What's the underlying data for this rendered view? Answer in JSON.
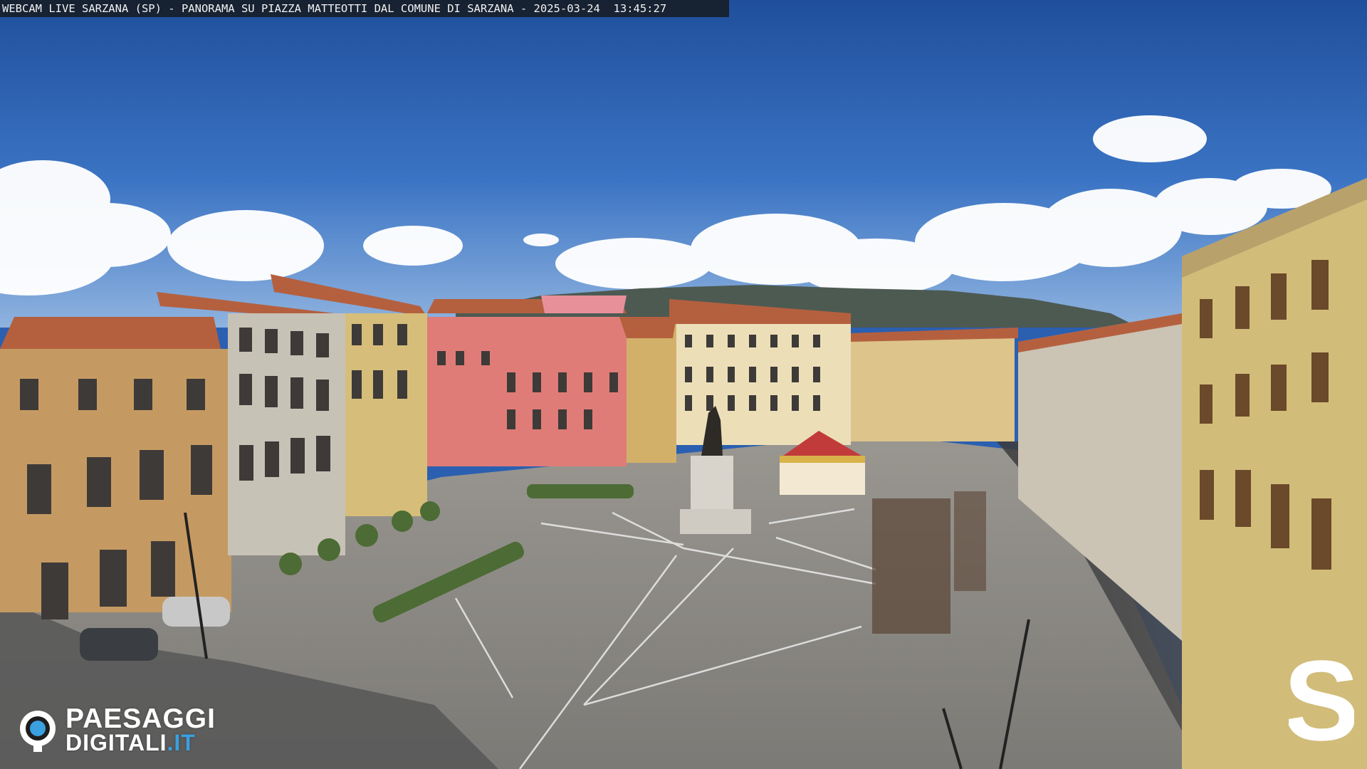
{
  "overlay": {
    "caption": "WEBCAM LIVE SARZANA (SP) - PANORAMA SU PIAZZA MATTEOTTI DAL COMUNE DI SARZANA - 2025-03-24  13:45:27"
  },
  "watermark": {
    "brand_line1": "PAESAGGI",
    "brand_line2": "DIGITALI",
    "brand_tld": ".IT",
    "corner_letter": "S",
    "accent_color": "#3aa0e0"
  },
  "colors": {
    "sky": "#2d63b5",
    "pavement": "#8a8884",
    "facade_pink": "#e07c78",
    "facade_ochre": "#d8b75e",
    "roof": "#b5623f"
  }
}
